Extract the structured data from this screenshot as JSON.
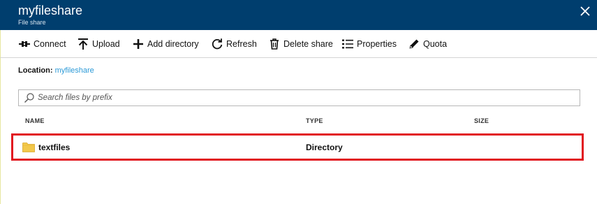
{
  "header": {
    "title": "myfileshare",
    "subtitle": "File share",
    "close_icon": "close-icon",
    "background": "#003e6e"
  },
  "toolbar": {
    "items": [
      {
        "label": "Connect",
        "icon": "connect-icon"
      },
      {
        "label": "Upload",
        "icon": "upload-icon"
      },
      {
        "label": "Add directory",
        "icon": "plus-icon"
      },
      {
        "label": "Refresh",
        "icon": "refresh-icon"
      },
      {
        "label": "Delete share",
        "icon": "trash-icon"
      },
      {
        "label": "Properties",
        "icon": "list-icon"
      },
      {
        "label": "Quota",
        "icon": "pencil-icon"
      }
    ]
  },
  "location": {
    "label": "Location:",
    "path": "myfileshare",
    "link_color": "#2c9ad7"
  },
  "search": {
    "placeholder": "Search files by prefix",
    "value": ""
  },
  "table": {
    "columns": [
      "NAME",
      "TYPE",
      "SIZE"
    ],
    "rows": [
      {
        "name": "textfiles",
        "type": "Directory",
        "size": "",
        "icon": "folder-icon"
      }
    ],
    "highlight_color": "#e1161f"
  }
}
